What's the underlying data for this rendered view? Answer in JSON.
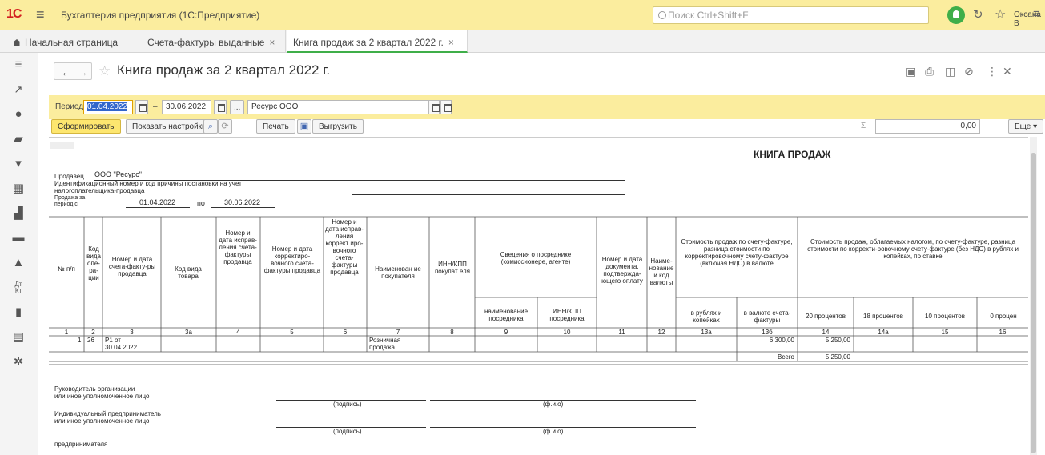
{
  "app": {
    "logo": "1С",
    "title": "Бухгалтерия предприятия (1С:Предприятие)",
    "search_placeholder": "Поиск Ctrl+Shift+F",
    "user": "Оксана В"
  },
  "tabs": [
    {
      "label": "Начальная страница"
    },
    {
      "label": "Счета-фактуры выданные"
    },
    {
      "label": "Книга продаж за 2 квартал 2022 г."
    }
  ],
  "document": {
    "title": "Книга продаж за 2 квартал 2022 г."
  },
  "period": {
    "label": "Период:",
    "from": "01.04.2022",
    "dash": "–",
    "to": "30.06.2022",
    "ellipsis": "...",
    "org": "Ресурс ООО"
  },
  "toolbar": {
    "generate": "Сформировать",
    "settings": "Показать настройки",
    "print": "Печать",
    "export": "Выгрузить",
    "sum_symbol": "Σ",
    "sum_value": "0,00",
    "more": "Еще"
  },
  "report": {
    "heading": "КНИГА ПРОДАЖ",
    "seller_label": "Продавец",
    "seller_value": "ООО \"Ресурс\"",
    "inn_label": "Идентификационный номер и код причины постановки на учет",
    "inn_label2": "налогоплательщика-продавца",
    "period_label1": "Продажа за",
    "period_label2": "период с",
    "period_from": "01.04.2022",
    "period_po": "по",
    "period_to": "30.06.2022",
    "headers": {
      "h1": "№ п/п",
      "h2": "Код вида опе-ра-ции",
      "h3": "Номер и дата счета-факту-ры продавца",
      "h3a": "Код вида товара",
      "h4": "Номер и дата исправ-ления счета-фактуры продавца",
      "h5": "Номер и дата корректиро-вочного счета-фактуры продавца",
      "h6": "Номер и дата исправ-ления коррект иро-вочного счета-фактуры продавца",
      "h7": "Наименован ие покупателя",
      "h8": "ИНН/КПП покупат еля",
      "h9_10": "Сведения о посреднике (комиссионере, агенте)",
      "h9": "наименование посредника",
      "h10": "ИНН/КПП посредника",
      "h11": "Номер и дата документа, подтвержда-ющего оплату",
      "h12": "Наиме-нование и код валюты",
      "h13": "Стоимость продаж по счету-фактуре, разница стоимости по корректировочному счету-фактуре (включая НДС) в валюте",
      "h13a": "в валюте счета-фактуры",
      "h13b": "в рублях и копейках",
      "h14_16": "Стоимость продаж, облагаемых налогом, по счету-фактуре, разница стоимости по корректи-ровочному счету-фактуре (без НДС) в рублях и копейках, по ставке",
      "h14": "20 процентов",
      "h14a": "18 процентов",
      "h15": "10 процентов",
      "h16": "0 процен"
    },
    "col_numbers": [
      "1",
      "2",
      "3",
      "3а",
      "4",
      "5",
      "6",
      "7",
      "8",
      "9",
      "10",
      "11",
      "12",
      "13а",
      "13б",
      "14",
      "14а",
      "15",
      "16"
    ],
    "row": {
      "num": "1",
      "op_code": "26",
      "invoice": "Р1 от 30.04.2022",
      "buyer": "Розничная продажа",
      "amount_rub": "6 300,00",
      "amount_20": "5 250,00"
    },
    "total_label": "Всего",
    "total_20": "5 250,00",
    "sign1_label1": "Руководитель организации",
    "sign1_label2": "или иное уполномоченное лицо",
    "sign_sub": "(подпись)",
    "fio_sub": "(ф.и.о)",
    "sign2_label1": "Индивидуальный предприниматель",
    "sign2_label2": "или иное уполномоченное лицо",
    "sign3_label": "предпринимателя"
  }
}
